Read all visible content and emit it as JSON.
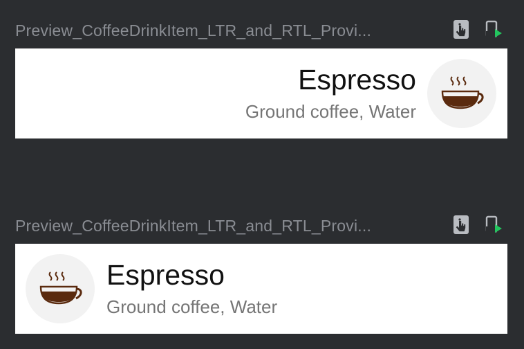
{
  "colors": {
    "background": "#2b2d30",
    "header_text": "#8a8d93",
    "card": "#ffffff",
    "title_text": "#111111",
    "subtitle_text": "#757575",
    "avatar_bg": "#f2f2f2",
    "coffee": "#5a2a0e",
    "deploy_green": "#22c55e"
  },
  "previews": [
    {
      "title": "Preview_CoffeeDrinkItem_LTR_and_RTL_Provi...",
      "direction": "rtl",
      "icons": [
        "interactive-mode-icon",
        "deploy-preview-icon"
      ],
      "item": {
        "name": "Espresso",
        "ingredients": "Ground coffee, Water",
        "image_icon": "coffee-cup-icon"
      }
    },
    {
      "title": "Preview_CoffeeDrinkItem_LTR_and_RTL_Provi...",
      "direction": "ltr",
      "icons": [
        "interactive-mode-icon",
        "deploy-preview-icon"
      ],
      "item": {
        "name": "Espresso",
        "ingredients": "Ground coffee, Water",
        "image_icon": "coffee-cup-icon"
      }
    }
  ]
}
